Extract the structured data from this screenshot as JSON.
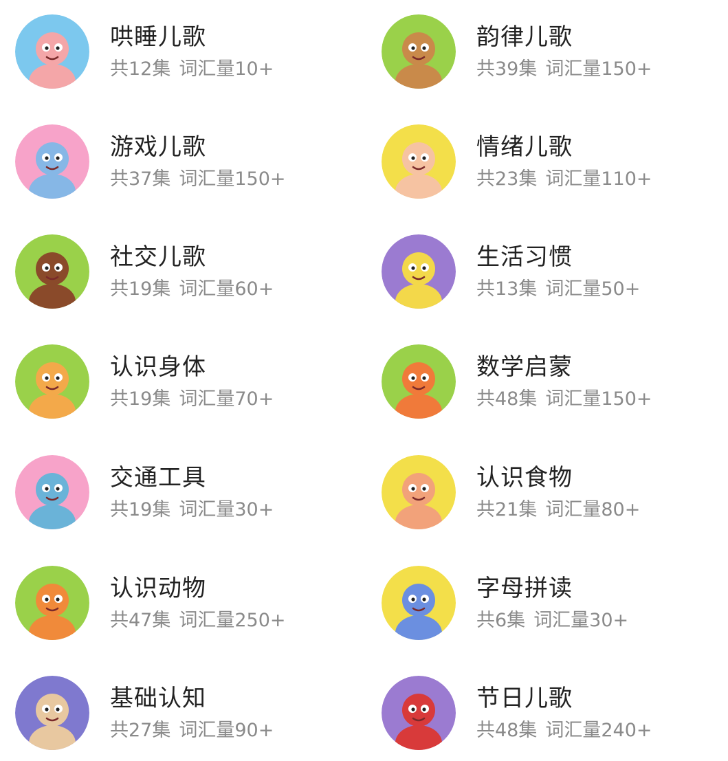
{
  "items": [
    {
      "title": "哄睡儿歌",
      "episodes": "共12集",
      "vocab": "词汇量10+",
      "bg": "#7cc8ee",
      "fg": "#f4a6a8",
      "icon": "cat-violin-icon"
    },
    {
      "title": "韵律儿歌",
      "episodes": "共39集",
      "vocab": "词汇量150+",
      "bg": "#9ad14a",
      "fg": "#c98a4a",
      "icon": "ostrich-icon"
    },
    {
      "title": "游戏儿歌",
      "episodes": "共37集",
      "vocab": "词汇量150+",
      "bg": "#f7a3c9",
      "fg": "#86b7e6",
      "icon": "elephant-icon"
    },
    {
      "title": "情绪儿歌",
      "episodes": "共23集",
      "vocab": "词汇量110+",
      "bg": "#f3df4a",
      "fg": "#f6c3a2",
      "icon": "boy-icon"
    },
    {
      "title": "社交儿歌",
      "episodes": "共19集",
      "vocab": "词汇量60+",
      "bg": "#9ad14a",
      "fg": "#8a4a2a",
      "icon": "waving-kid-icon"
    },
    {
      "title": "生活习惯",
      "episodes": "共13集",
      "vocab": "词汇量50+",
      "bg": "#9b7bd1",
      "fg": "#f3d84a",
      "icon": "monster-icon"
    },
    {
      "title": "认识身体",
      "episodes": "共19集",
      "vocab": "词汇量70+",
      "bg": "#9ad14a",
      "fg": "#f3a94a",
      "icon": "fox-icon"
    },
    {
      "title": "数学启蒙",
      "episodes": "共48集",
      "vocab": "词汇量150+",
      "bg": "#9ad14a",
      "fg": "#f07a3a",
      "icon": "numbers-kid-icon"
    },
    {
      "title": "交通工具",
      "episodes": "共19集",
      "vocab": "词汇量30+",
      "bg": "#f7a3c9",
      "fg": "#6ab3d8",
      "icon": "cyclist-icon"
    },
    {
      "title": "认识食物",
      "episodes": "共21集",
      "vocab": "词汇量80+",
      "bg": "#f3df4a",
      "fg": "#f2a27a",
      "icon": "girl-icecream-icon"
    },
    {
      "title": "认识动物",
      "episodes": "共47集",
      "vocab": "词汇量250+",
      "bg": "#9ad14a",
      "fg": "#f08a3a",
      "icon": "dinosaur-icon"
    },
    {
      "title": "字母拼读",
      "episodes": "共6集",
      "vocab": "词汇量30+",
      "bg": "#f3df4a",
      "fg": "#6b8fe0",
      "icon": "letter-b-icon"
    },
    {
      "title": "基础认知",
      "episodes": "共27集",
      "vocab": "词汇量90+",
      "bg": "#7f79cf",
      "fg": "#e8c8a0",
      "icon": "hooded-kid-icon"
    },
    {
      "title": "节日儿歌",
      "episodes": "共48集",
      "vocab": "词汇量240+",
      "bg": "#9b7bd1",
      "fg": "#d83a3a",
      "icon": "santa-icon"
    }
  ]
}
